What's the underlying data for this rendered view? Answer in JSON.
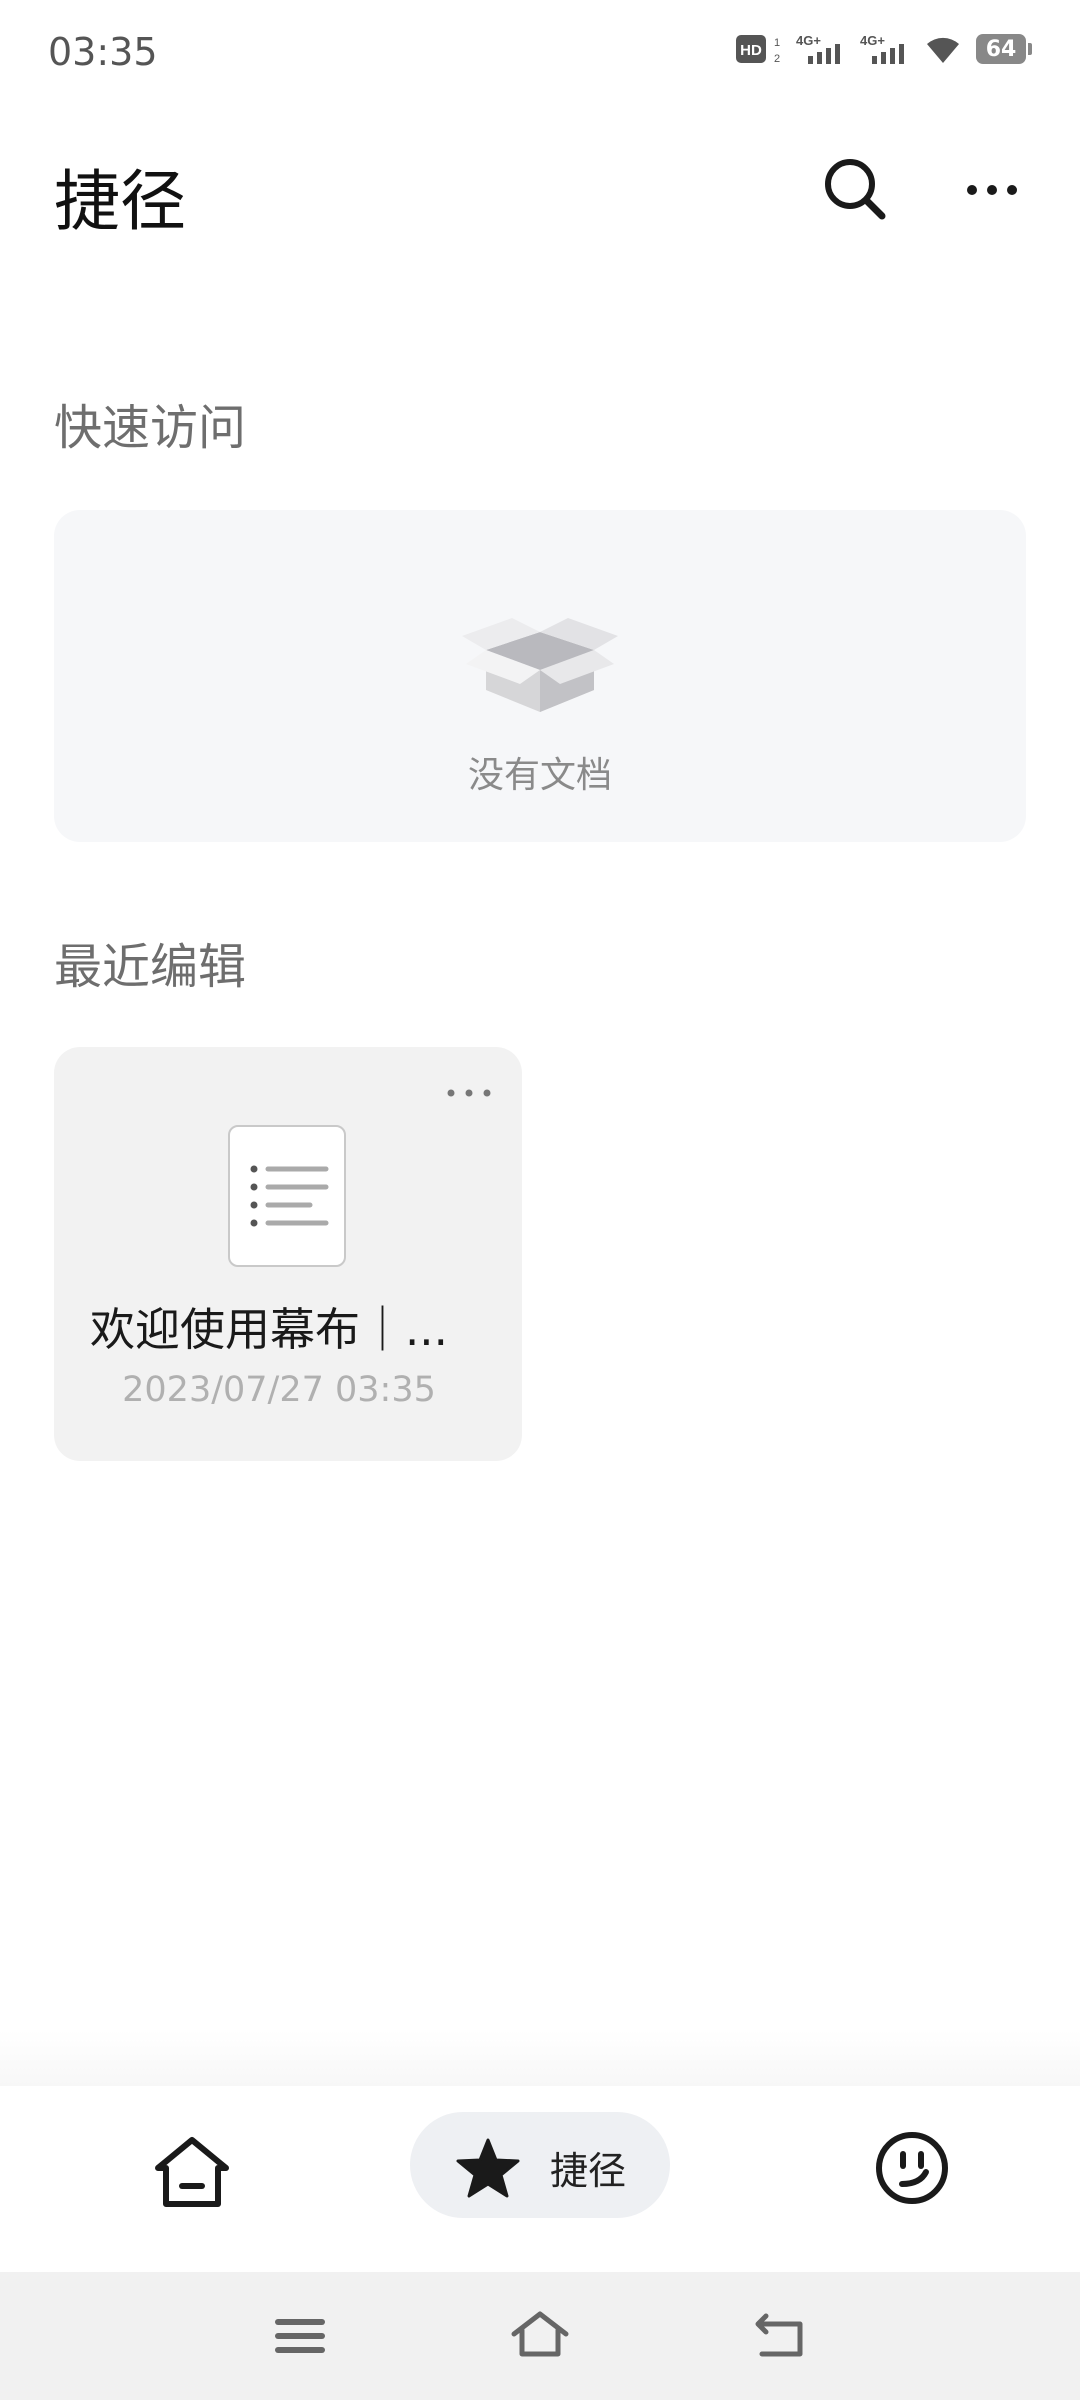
{
  "status_bar": {
    "time": "03:35",
    "battery_level": "64",
    "network": [
      "HD",
      "4G+",
      "4G+",
      "wifi"
    ]
  },
  "header": {
    "title": "捷径",
    "search_icon": "search-icon",
    "more_icon": "more-horizontal-icon"
  },
  "quick_access": {
    "title": "快速访问",
    "empty_text": "没有文档",
    "empty_icon": "open-box-icon"
  },
  "recent": {
    "title": "最近编辑",
    "items": [
      {
        "name": "欢迎使用幕布｜...",
        "date": "2023/07/27 03:35",
        "icon": "document-list-icon"
      }
    ]
  },
  "tab_bar": {
    "tabs": [
      {
        "id": "home",
        "icon": "home-icon",
        "label": ""
      },
      {
        "id": "shortcut",
        "icon": "star-icon",
        "label": "捷径",
        "active": true
      },
      {
        "id": "me",
        "icon": "smiley-icon",
        "label": ""
      }
    ]
  },
  "system_nav": {
    "buttons": [
      "menu-icon",
      "home-icon",
      "back-icon"
    ]
  },
  "colors": {
    "background": "#ffffff",
    "card": "#f6f7f9",
    "active_tab": "#eef0f3",
    "section_title": "#6e6e6e"
  }
}
